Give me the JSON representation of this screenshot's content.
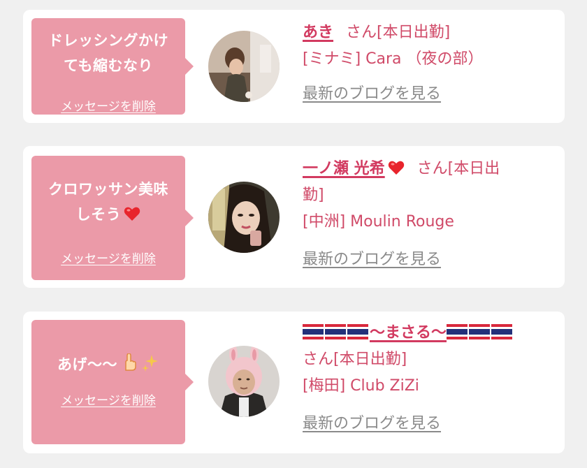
{
  "messages": [
    {
      "bubble_lines": [
        "ドレッシングかけ",
        "ても縮むなり"
      ],
      "delete_label": "メッセージを削除",
      "name": "あき",
      "status": "さん[本日出勤]",
      "shop": "[ミナミ] Cara （夜の部）",
      "blog_label": "最新のブログを見る",
      "avatar_icon": "avatar-photo-icon"
    },
    {
      "bubble_lines": [
        "クロワッサン美味",
        "しそう"
      ],
      "delete_label": "メッセージを削除",
      "name": "一ノ瀬 光希",
      "status": "さん[本日出",
      "status_cont": "勤]",
      "shop": "[中洲] Moulin Rouge",
      "blog_label": "最新のブログを見る",
      "avatar_icon": "avatar-photo-icon"
    },
    {
      "bubble_lines": [
        "あげ〜〜"
      ],
      "delete_label": "メッセージを削除",
      "name": "〜まさる〜",
      "status": "さん[本日出勤]",
      "shop": "[梅田] Club ZiZi",
      "blog_label": "最新のブログを見る",
      "avatar_icon": "avatar-photo-icon"
    }
  ],
  "colors": {
    "bubble": "#eb9aa8",
    "accent": "#d04a68",
    "link_gray": "#8a8a8a",
    "background": "#f0f0f0"
  }
}
